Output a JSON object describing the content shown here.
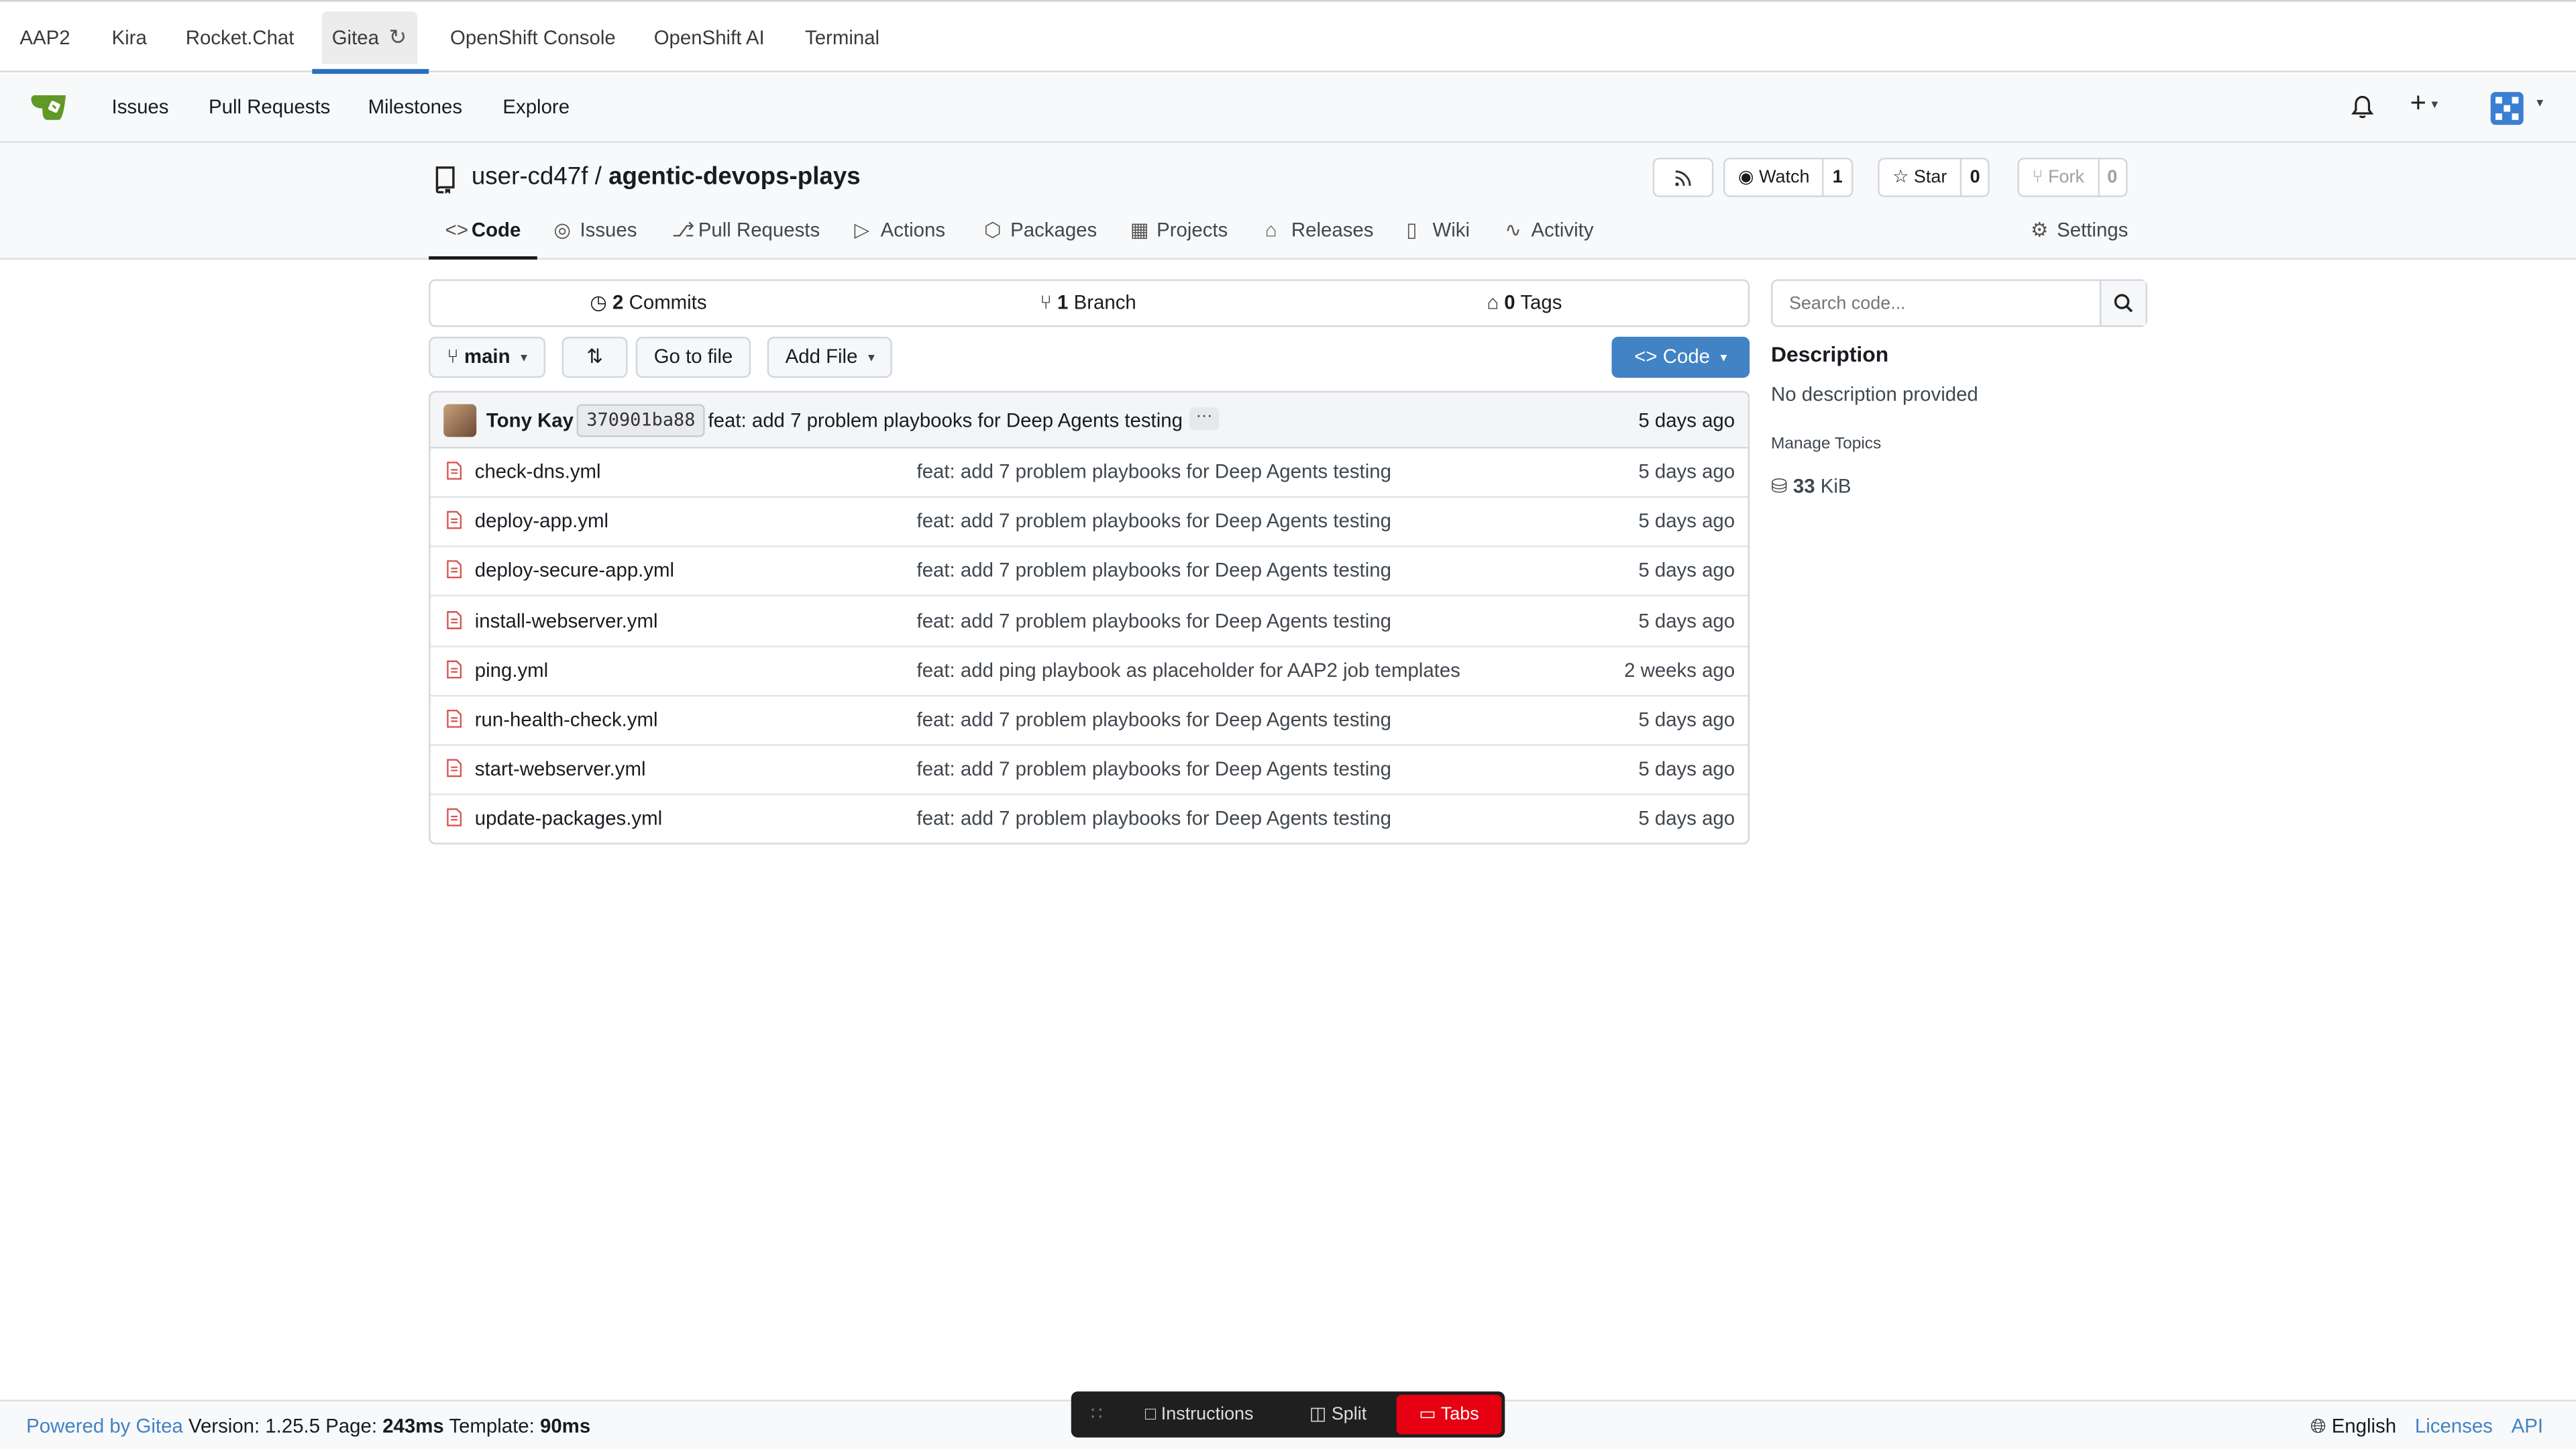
{
  "browser_tabs": [
    {
      "label": "AAP2"
    },
    {
      "label": "Kira"
    },
    {
      "label": "Rocket.Chat"
    },
    {
      "label": "Gitea"
    },
    {
      "label": "OpenShift Console"
    },
    {
      "label": "OpenShift AI"
    },
    {
      "label": "Terminal"
    }
  ],
  "nav": {
    "items": [
      "Issues",
      "Pull Requests",
      "Milestones",
      "Explore"
    ]
  },
  "repo": {
    "owner": "user-cd47f",
    "separator": "/",
    "name": "agentic-devops-plays",
    "watch_label": "Watch",
    "watch_count": "1",
    "star_label": "Star",
    "star_count": "0",
    "fork_label": "Fork",
    "fork_count": "0",
    "tabs": [
      "Code",
      "Issues",
      "Pull Requests",
      "Actions",
      "Packages",
      "Projects",
      "Releases",
      "Wiki",
      "Activity"
    ],
    "settings_label": "Settings"
  },
  "summary": {
    "commits_count": "2",
    "commits_label": "Commits",
    "branch_count": "1",
    "branch_label": "Branch",
    "tags_count": "0",
    "tags_label": "Tags"
  },
  "toolbar": {
    "branch": "main",
    "go_to_file": "Go to file",
    "add_file": "Add File",
    "code": "Code"
  },
  "latest_commit": {
    "author": "Tony Kay",
    "sha": "370901ba88",
    "message": "feat: add 7 problem playbooks for Deep Agents testing",
    "dots": "···",
    "time": "5 days ago"
  },
  "files": [
    {
      "name": "check-dns.yml",
      "message": "feat: add 7 problem playbooks for Deep Agents testing",
      "time": "5 days ago"
    },
    {
      "name": "deploy-app.yml",
      "message": "feat: add 7 problem playbooks for Deep Agents testing",
      "time": "5 days ago"
    },
    {
      "name": "deploy-secure-app.yml",
      "message": "feat: add 7 problem playbooks for Deep Agents testing",
      "time": "5 days ago"
    },
    {
      "name": "install-webserver.yml",
      "message": "feat: add 7 problem playbooks for Deep Agents testing",
      "time": "5 days ago"
    },
    {
      "name": "ping.yml",
      "message": "feat: add ping playbook as placeholder for AAP2 job templates",
      "time": "2 weeks ago"
    },
    {
      "name": "run-health-check.yml",
      "message": "feat: add 7 problem playbooks for Deep Agents testing",
      "time": "5 days ago"
    },
    {
      "name": "start-webserver.yml",
      "message": "feat: add 7 problem playbooks for Deep Agents testing",
      "time": "5 days ago"
    },
    {
      "name": "update-packages.yml",
      "message": "feat: add 7 problem playbooks for Deep Agents testing",
      "time": "5 days ago"
    }
  ],
  "sidebar": {
    "search_placeholder": "Search code...",
    "description_title": "Description",
    "description_text": "No description provided",
    "manage_topics": "Manage Topics",
    "size_value": "33",
    "size_unit": "KiB"
  },
  "footer": {
    "powered_by": "Powered by Gitea",
    "version_text": "Version: 1.25.5 Page:",
    "page_time": "243ms",
    "template_label": "Template:",
    "template_time": "90ms",
    "language": "English",
    "licenses": "Licenses",
    "api": "API"
  },
  "dock": {
    "instructions": "Instructions",
    "split": "Split",
    "tabs": "Tabs"
  },
  "colors": {
    "accent": "#4183c4",
    "tab_underline": "#2c6fbf",
    "dock_active": "#e60012",
    "file_icon": "#d9534f"
  }
}
